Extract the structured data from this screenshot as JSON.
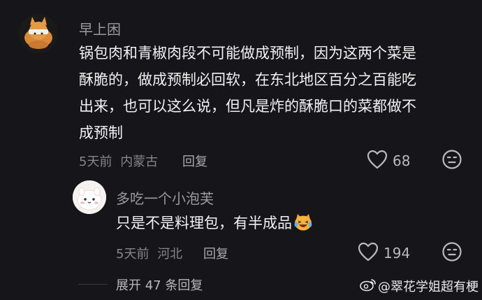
{
  "comment": {
    "author": "早上困",
    "lines": [
      "锅包肉和青椒肉段不可能做成预制，因为这两个菜是",
      "酥脆的，做成预制必回软，在东北地区百分之百能吃",
      "出来，也可以这么说，但凡是炸的酥脆口的菜都做不",
      "成预制"
    ],
    "time": "5天前",
    "location": "内蒙古",
    "reply_label": "回复",
    "likes": "68"
  },
  "reply": {
    "author": "多吃一个小泡芙",
    "text": "只是不是料理包，有半成品",
    "emoji": "crying-laughing-cat-emoji",
    "time": "5天前",
    "location": "河北",
    "reply_label": "回复",
    "likes": "194"
  },
  "expand_label": "展开 47 条回复",
  "watermark": "@翠花学姐超有梗",
  "colors": {
    "background": "#16161a",
    "primary_text": "#f2f2f2",
    "secondary_text": "#85858c"
  }
}
